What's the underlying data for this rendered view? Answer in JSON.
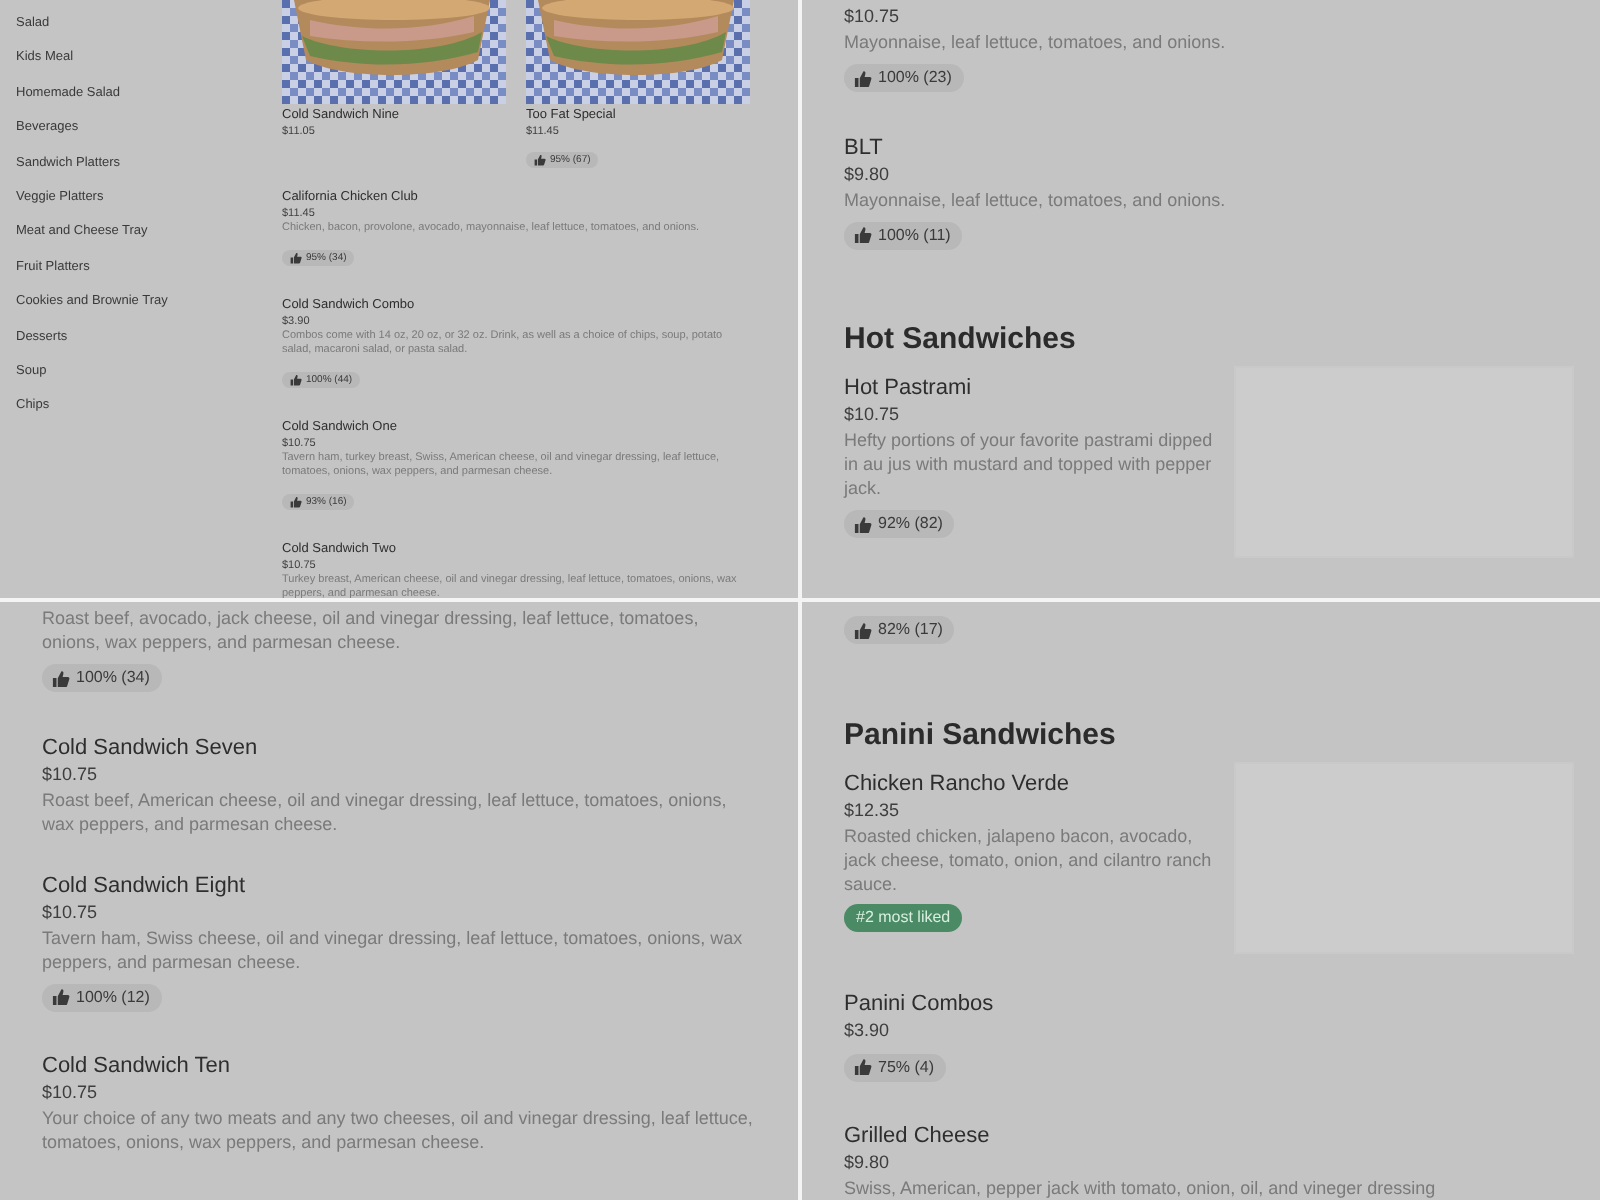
{
  "panels": [
    {
      "kind": "compact",
      "categories": [
        "Salad",
        "Kids Meal",
        "Homemade Salad",
        "Beverages",
        "Sandwich Platters",
        "Veggie Platters",
        "Meat and Cheese Tray",
        "Fruit Platters",
        "Cookies and Brownie Tray",
        "Desserts",
        "Soup",
        "Chips"
      ],
      "featured": [
        {
          "name": "Cold Sandwich Nine",
          "price": "$11.05",
          "kind": "picture"
        },
        {
          "name": "Too Fat Special",
          "price": "$11.45",
          "rating": "95% (67)",
          "kind": "picture"
        }
      ],
      "items": [
        {
          "name": "California Chicken Club",
          "price": "$11.45",
          "description": "Chicken, bacon, provolone, avocado, mayonnaise, leaf lettuce, tomatoes, and onions.",
          "rating": "95% (34)"
        },
        {
          "name": "Cold Sandwich Combo",
          "price": "$3.90",
          "description": "Combos come with 14 oz, 20 oz, or 32 oz. Drink, as well as a choice of chips, soup, potato salad, macaroni salad, or pasta salad.",
          "rating": "100% (44)"
        },
        {
          "name": "Cold Sandwich One",
          "price": "$10.75",
          "description": "Tavern ham, turkey breast, Swiss, American cheese, oil and vinegar dressing, leaf lettuce, tomatoes, onions, wax peppers, and parmesan cheese.",
          "rating": "93% (16)"
        },
        {
          "name": "Cold Sandwich Two",
          "price": "$10.75",
          "description": "Turkey breast, American cheese, oil and vinegar dressing, leaf lettuce, tomatoes, onions, wax peppers, and parmesan cheese."
        }
      ]
    },
    {
      "kind": "full",
      "sections": [
        {
          "items": [
            {
              "price": "$10.75",
              "description": "Mayonnaise, leaf lettuce, tomatoes, and onions.",
              "rating": "100% (23)"
            },
            {
              "name": "BLT",
              "price": "$9.80",
              "description": "Mayonnaise, leaf lettuce, tomatoes, and onions.",
              "rating": "100% (11)"
            }
          ]
        },
        {
          "title": "Hot Sandwiches",
          "items": [
            {
              "name": "Hot Pastrami",
              "price": "$10.75",
              "description": "Hefty portions of your favorite pastrami dipped in au jus with mustard and topped with pepper jack.",
              "rating": "92% (82)",
              "image": true
            }
          ]
        }
      ]
    },
    {
      "kind": "full",
      "sections": [
        {
          "items": [
            {
              "description": "Roast beef, avocado, jack cheese, oil and vinegar dressing, leaf lettuce, tomatoes, onions, wax peppers, and parmesan cheese.",
              "rating": "100% (34)"
            },
            {
              "name": "Cold Sandwich Seven",
              "price": "$10.75",
              "description": "Roast beef, American cheese, oil and vinegar dressing, leaf lettuce, tomatoes, onions, wax peppers, and parmesan cheese."
            },
            {
              "name": "Cold Sandwich Eight",
              "price": "$10.75",
              "description": "Tavern ham, Swiss cheese, oil and vinegar dressing, leaf lettuce, tomatoes, onions, wax peppers, and parmesan cheese.",
              "rating": "100% (12)"
            },
            {
              "name": "Cold Sandwich Ten",
              "price": "$10.75",
              "description": "Your choice of any two meats and any two cheeses, oil and vinegar dressing, leaf lettuce, tomatoes, onions, wax peppers, and parmesan cheese."
            }
          ]
        }
      ]
    },
    {
      "kind": "full",
      "sections": [
        {
          "items": [
            {
              "rating": "82% (17)"
            }
          ]
        },
        {
          "title": "Panini Sandwiches",
          "items": [
            {
              "name": "Chicken Rancho Verde",
              "price": "$12.35",
              "description": "Roasted chicken, jalapeno bacon, avocado, jack cheese, tomato, onion, and cilantro ranch sauce.",
              "badge": "#2 most liked",
              "image": true
            },
            {
              "name": "Panini Combos",
              "price": "$3.90",
              "rating": "75% (4)"
            },
            {
              "name": "Grilled Cheese",
              "price": "$9.80",
              "description": "Swiss, American, pepper jack with tomato, onion, oil, and vineger dressing"
            }
          ]
        }
      ]
    }
  ]
}
